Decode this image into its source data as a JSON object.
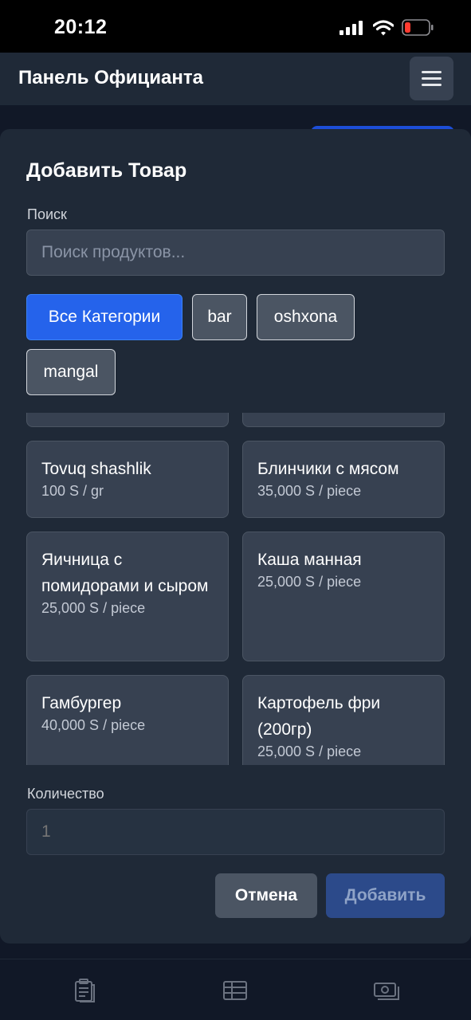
{
  "status_bar": {
    "time": "20:12"
  },
  "header": {
    "title": "Панель Официанта"
  },
  "modal": {
    "title": "Добавить Товар",
    "search_label": "Поиск",
    "search_placeholder": "Поиск продуктов...",
    "categories": [
      "Все Категории",
      "bar",
      "oshxona",
      "mangal"
    ],
    "active_category": "Все Категории",
    "products": [
      {
        "name": "Tovuq shashlik",
        "price": "100 S / gr"
      },
      {
        "name": "Блинчики с мясом",
        "price": "35,000 S / piece"
      },
      {
        "name": "Яичница с помидорами и сыром",
        "price": "25,000 S / piece"
      },
      {
        "name": "Каша манная",
        "price": "25,000 S / piece"
      },
      {
        "name": "Гамбургер",
        "price": "40,000 S / piece"
      },
      {
        "name": "Картофель фри (200гр)",
        "price": "25,000 S / piece"
      }
    ],
    "quantity_label": "Количество",
    "quantity_value": "1",
    "cancel_label": "Отмена",
    "add_label": "Добавить"
  },
  "bottom_nav": {
    "icons": [
      "clipboard-icon",
      "table-icon",
      "cash-icon"
    ]
  },
  "colors": {
    "accent": "#2563eb",
    "background": "#111827",
    "surface": "#1f2937",
    "card": "#374151"
  }
}
